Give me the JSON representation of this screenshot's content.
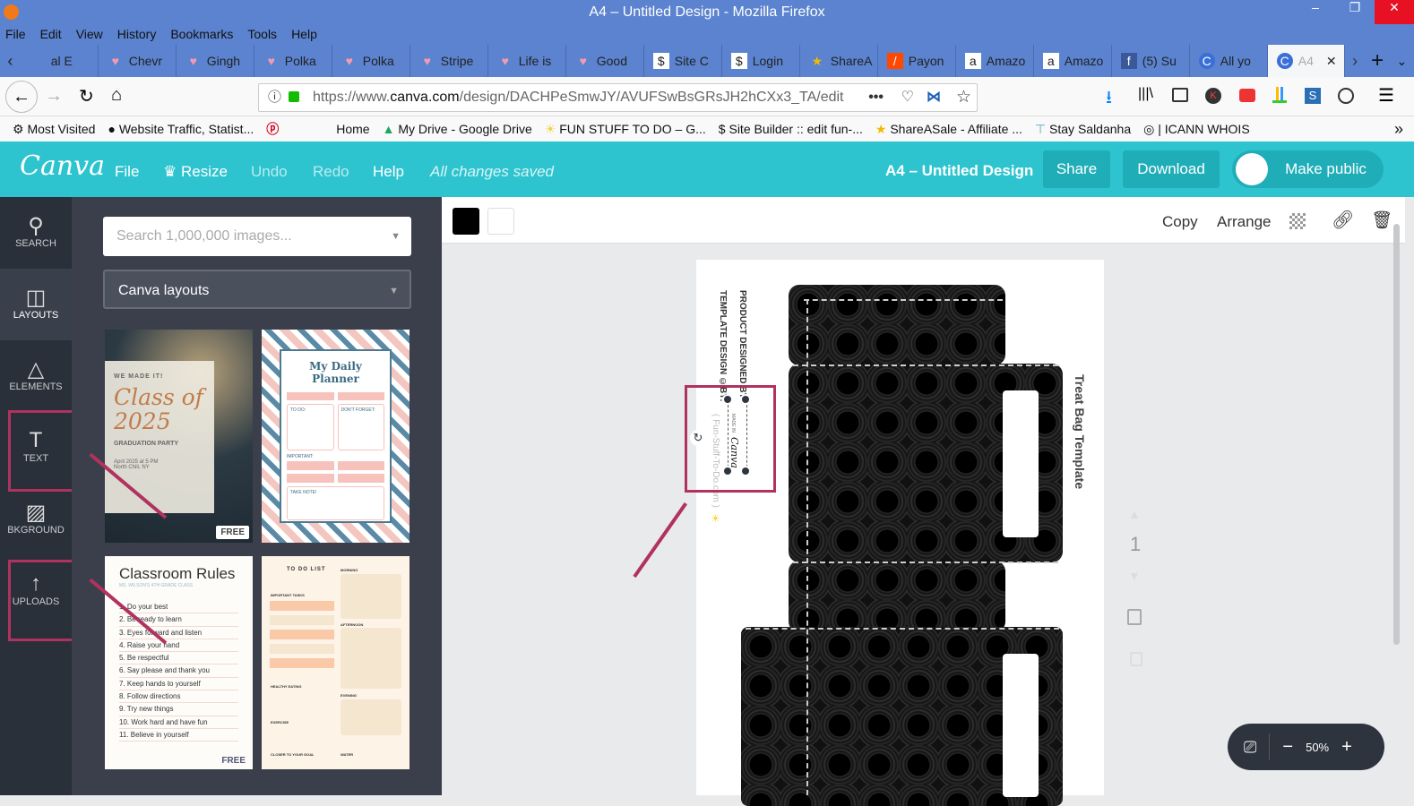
{
  "window": {
    "title": "A4 – Untitled Design - Mozilla Firefox",
    "controls": [
      "–",
      "❐",
      "✕"
    ]
  },
  "menu": [
    "File",
    "Edit",
    "View",
    "History",
    "Bookmarks",
    "Tools",
    "Help"
  ],
  "tabs": [
    {
      "label": "al E",
      "icon": "tab-icon"
    },
    {
      "label": "Chevr",
      "icon": "heart-icon"
    },
    {
      "label": "Gingh",
      "icon": "heart-icon"
    },
    {
      "label": "Polka",
      "icon": "heart-icon"
    },
    {
      "label": "Polka",
      "icon": "heart-icon"
    },
    {
      "label": "Stripe",
      "icon": "heart-icon"
    },
    {
      "label": "Life is",
      "icon": "heart-icon"
    },
    {
      "label": "Good",
      "icon": "heart-icon"
    },
    {
      "label": "Site C",
      "icon": "sitebuilder-icon"
    },
    {
      "label": "Login",
      "icon": "sitebuilder-icon"
    },
    {
      "label": "ShareA",
      "icon": "star-icon"
    },
    {
      "label": "Payon",
      "icon": "payoneer-icon"
    },
    {
      "label": "Amazo",
      "icon": "amazon-icon"
    },
    {
      "label": "Amazo",
      "icon": "amazon-icon"
    },
    {
      "label": "(5) Su",
      "icon": "facebook-icon"
    },
    {
      "label": "All yo",
      "icon": "canva-icon"
    },
    {
      "label": "A4",
      "icon": "canva-icon",
      "active": true
    }
  ],
  "url": {
    "prefix": "https://www.",
    "domain": "canva.com",
    "path": "/design/DACHPeSmwJY/AVUFSwBsGRsJH2hCXx3_TA/edit"
  },
  "bookmarks": [
    "Most Visited",
    "Website Traffic, Statist...",
    "Home",
    "My Drive - Google Drive",
    "FUN STUFF TO DO – G...",
    "Site Builder :: edit fun-...",
    "ShareASale - Affiliate ...",
    "Stay Saldanha",
    "| ICANN WHOIS"
  ],
  "canva": {
    "logo": "Canva",
    "menu": [
      "File",
      "Resize",
      "Undo",
      "Redo",
      "Help"
    ],
    "status": "All changes saved",
    "design_title": "A4 – Untitled Design",
    "share": "Share",
    "download": "Download",
    "make_public": "Make public"
  },
  "rail": [
    "SEARCH",
    "LAYOUTS",
    "ELEMENTS",
    "TEXT",
    "BKGROUND",
    "UPLOADS"
  ],
  "panel": {
    "search_placeholder": "Search 1,000,000 images...",
    "layouts_select": "Canva layouts",
    "thumbs": [
      {
        "lines": [
          "WE MADE IT!",
          "Class of 2025",
          "GRADUATION PARTY",
          "April 2025 at 5 PM",
          "North Chili, NY"
        ],
        "badge": "FREE"
      },
      {
        "lines": [
          "My Daily Planner",
          "TO DO:",
          "DON'T FORGET:",
          "IMPORTANT:",
          "TAKE NOTE!"
        ]
      },
      {
        "lines": [
          "Classroom Rules",
          "MS. WILSON'S 4TH GRADE CLASS",
          "1. Do your best",
          "2. Be ready to learn",
          "3. Eyes forward and listen",
          "4. Raise your hand",
          "5. Be respectful",
          "6. Say please and thank you",
          "7. Keep hands to yourself",
          "8. Follow directions",
          "9. Try new things",
          "10. Work hard and have fun",
          "11. Believe in yourself"
        ],
        "badge": "FREE"
      },
      {
        "lines": [
          "TO DO LIST",
          "MORNING",
          "IMPORTANT TASKS",
          "AFTERNOON",
          "HEALTHY EATING",
          "EVENING",
          "EXERCISE",
          "CLOSER TO YOUR GOAL",
          "WATER"
        ]
      }
    ]
  },
  "toolbar": {
    "colors": [
      "#000000",
      "#ffffff"
    ],
    "copy": "Copy",
    "arrange": "Arrange"
  },
  "design": {
    "product_line": "PRODUCT DESIGNED BY:",
    "template_line": "TEMPLATE DESIGN ©BY:",
    "credit": "( Fun-Stuff-To-Do.com )",
    "made_in": "MADE IN",
    "made_brand": "Canva",
    "side_title": "Treat Bag Template"
  },
  "page_number": "1",
  "zoom": "50%"
}
